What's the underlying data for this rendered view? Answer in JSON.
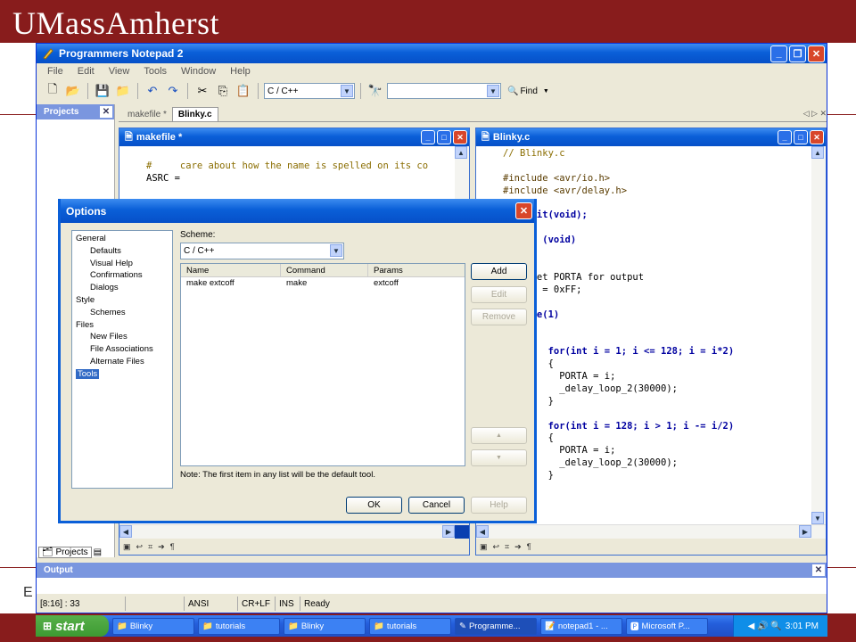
{
  "slide": {
    "brand": "UMassAmherst",
    "footer_text": "E"
  },
  "app": {
    "title": "Programmers Notepad 2",
    "menu": [
      "File",
      "Edit",
      "View",
      "Tools",
      "Window",
      "Help"
    ],
    "scheme_value": "C / C++",
    "search_value": "",
    "find_label": "Find",
    "projects_title": "Projects",
    "tabs": [
      "makefile *",
      "Blinky.c"
    ],
    "projects_tab": "Projects",
    "output_title": "Output",
    "status": [
      "[8:16] : 33",
      "",
      "ANSI",
      "CR+LF",
      "INS",
      "Ready"
    ]
  },
  "makefile": {
    "title": "makefile *",
    "lines": [
      "#     care about how the name is spelled on its co",
      "ASRC ="
    ]
  },
  "blinky": {
    "title": "Blinky.c",
    "lines": [
      "// Blinky.c",
      "",
      "#include <avr/io.h>",
      "#include <avr/delay.h>",
      "",
      "    wait(void);",
      "",
      "    in (void)",
      "",
      "",
      "     set PORTA for output",
      "    RA = 0xFF;",
      "",
      "    ile(1)",
      "",
      "",
      "        for(int i = 1; i <= 128; i = i*2)",
      "        {",
      "          PORTA = i;",
      "          _delay_loop_2(30000);",
      "        }",
      "",
      "        for(int i = 128; i > 1; i -= i/2)",
      "        {",
      "          PORTA = i;",
      "          _delay_loop_2(30000);",
      "        }"
    ]
  },
  "dialog": {
    "title": "Options",
    "tree": [
      {
        "label": "General",
        "level": 0
      },
      {
        "label": "Defaults",
        "level": 1
      },
      {
        "label": "Visual Help",
        "level": 1
      },
      {
        "label": "Confirmations",
        "level": 1
      },
      {
        "label": "Dialogs",
        "level": 1
      },
      {
        "label": "Style",
        "level": 0
      },
      {
        "label": "Schemes",
        "level": 1
      },
      {
        "label": "Files",
        "level": 0
      },
      {
        "label": "New Files",
        "level": 1
      },
      {
        "label": "File Associations",
        "level": 1
      },
      {
        "label": "Alternate Files",
        "level": 1
      },
      {
        "label": "Tools",
        "level": 0,
        "selected": true
      }
    ],
    "scheme_label": "Scheme:",
    "scheme_value": "C / C++",
    "columns": [
      "Name",
      "Command",
      "Params"
    ],
    "rows": [
      [
        "make extcoff",
        "make",
        "extcoff"
      ]
    ],
    "buttons": {
      "add": "Add",
      "edit": "Edit",
      "remove": "Remove",
      "up": "▲",
      "down": "▼",
      "ok": "OK",
      "cancel": "Cancel",
      "help": "Help"
    },
    "note": "Note: The first item in any list will be the default tool."
  },
  "taskbar": {
    "start": "start",
    "tasks": [
      "Blinky",
      "tutorials",
      "Blinky",
      "tutorials",
      "Programme...",
      "notepad1 - ...",
      "Microsoft P..."
    ],
    "clock": "3:01 PM"
  },
  "colors": {
    "accent": "#881c1c",
    "xp_blue": "#0a5fd8"
  }
}
